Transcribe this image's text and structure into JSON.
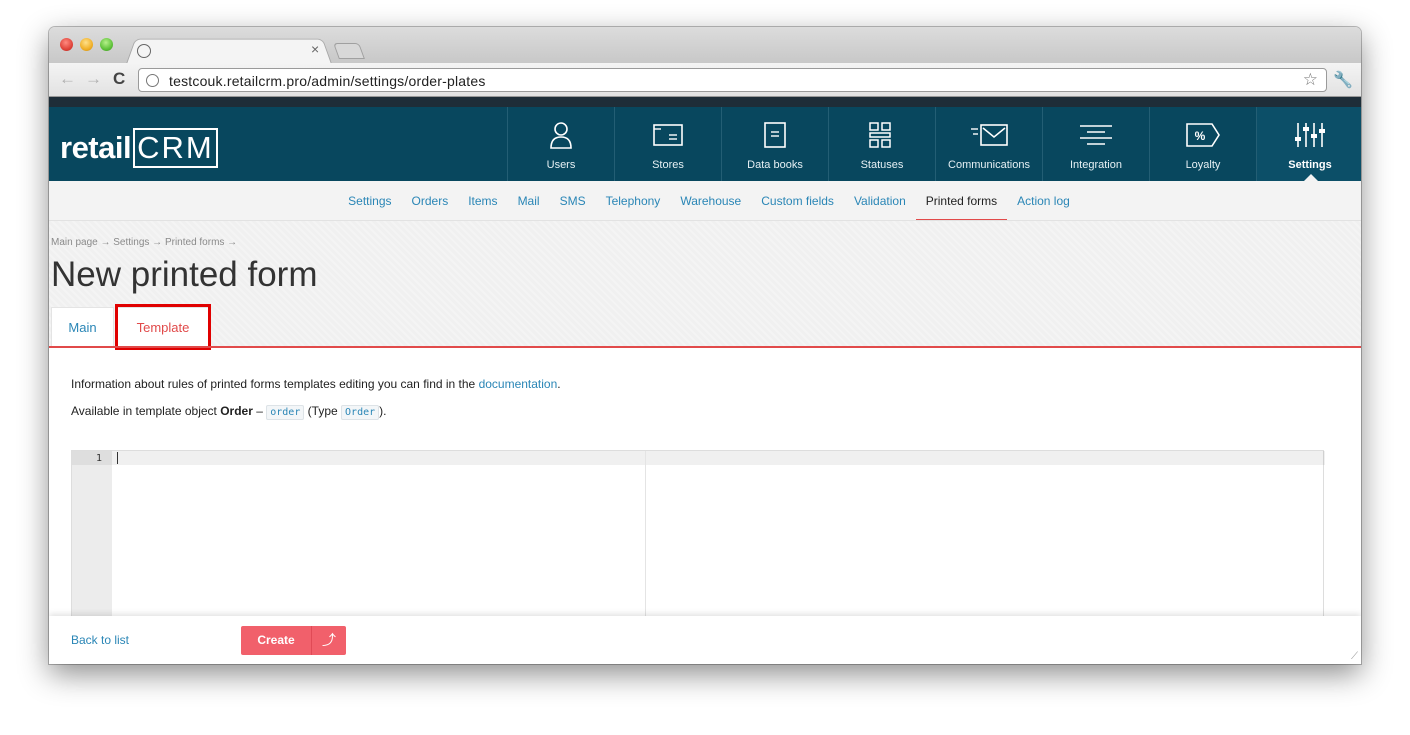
{
  "browser": {
    "url": "testcouk.retailcrm.pro/admin/settings/order-plates",
    "tab_close": "×"
  },
  "brand": {
    "logo_left": "retail",
    "logo_right": "CRM"
  },
  "topnav": [
    {
      "label": "Users",
      "icon": "user-icon"
    },
    {
      "label": "Stores",
      "icon": "store-icon"
    },
    {
      "label": "Data books",
      "icon": "book-icon"
    },
    {
      "label": "Statuses",
      "icon": "statuses-icon"
    },
    {
      "label": "Communications",
      "icon": "communications-icon"
    },
    {
      "label": "Integration",
      "icon": "integration-icon"
    },
    {
      "label": "Loyalty",
      "icon": "loyalty-icon",
      "glyph": "%"
    },
    {
      "label": "Settings",
      "icon": "settings-icon",
      "active": true
    }
  ],
  "subnav": [
    {
      "label": "Settings"
    },
    {
      "label": "Orders"
    },
    {
      "label": "Items"
    },
    {
      "label": "Mail"
    },
    {
      "label": "SMS"
    },
    {
      "label": "Telephony"
    },
    {
      "label": "Warehouse"
    },
    {
      "label": "Custom fields"
    },
    {
      "label": "Validation"
    },
    {
      "label": "Printed forms",
      "active": true
    },
    {
      "label": "Action log"
    }
  ],
  "breadcrumb": "Main page → Settings → Printed forms →",
  "page_title": "New printed form",
  "tabs": {
    "main": "Main",
    "template": "Template"
  },
  "info": {
    "line1_text": "Information about rules of printed forms templates editing you can find in the ",
    "line1_link": "documentation",
    "line1_end": ".",
    "line2_text": "Available in template object ",
    "line2_bold": "Order",
    "line2_dash": " – ",
    "line2_code1": "order",
    "line2_mid": " (Type ",
    "line2_code2": "Order",
    "line2_end": ")."
  },
  "editor": {
    "line_number": "1"
  },
  "footer": {
    "back_label": "Back to list",
    "create_label": "Create",
    "create_arrow": "⤴"
  },
  "colors": {
    "header": "#08475e",
    "accent_red": "#e14a4a",
    "link": "#2a86b6",
    "button": "#f1606b"
  }
}
